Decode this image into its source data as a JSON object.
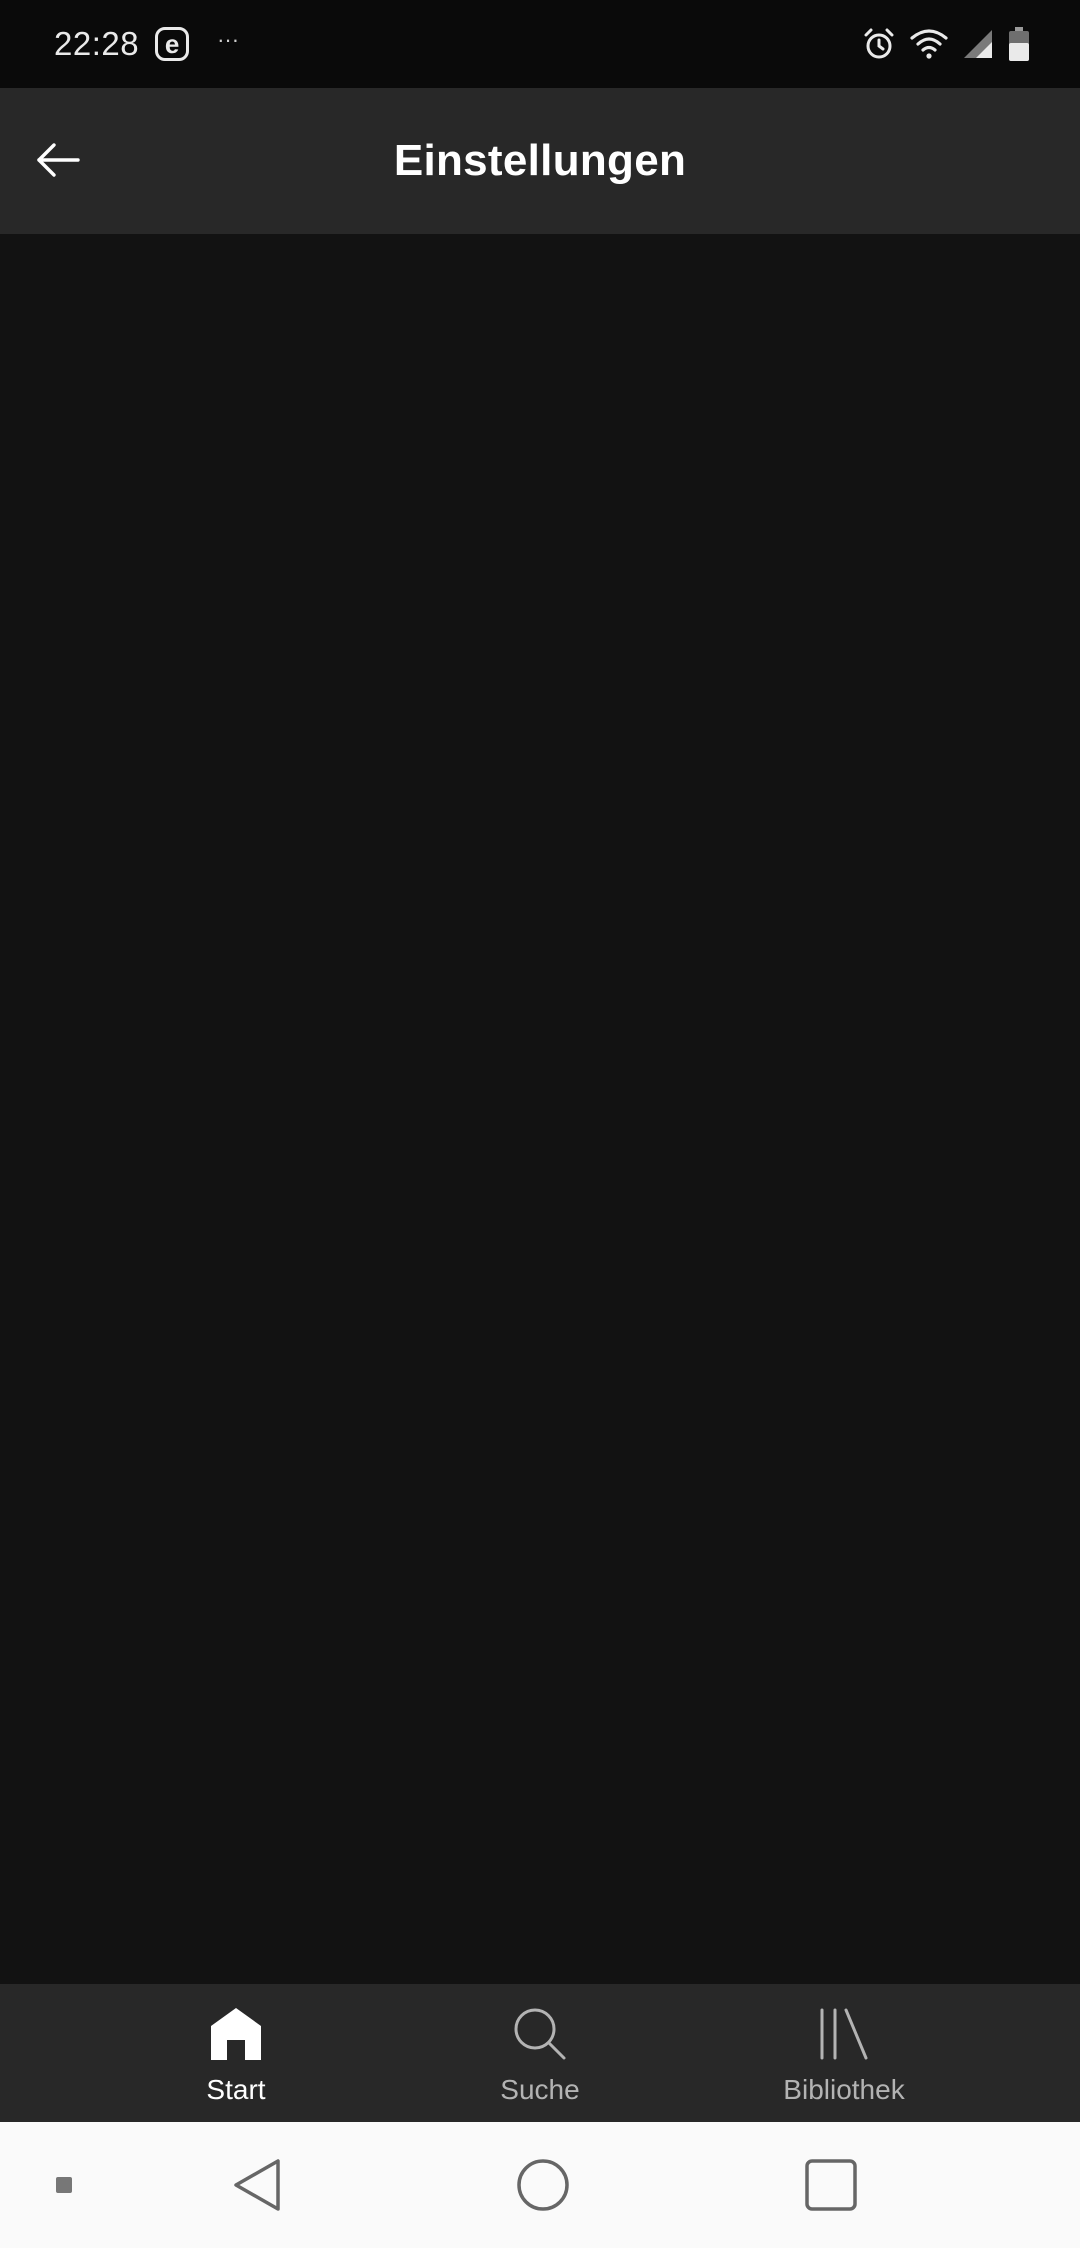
{
  "status_bar": {
    "time": "22:28",
    "badge": "e",
    "dots": "···"
  },
  "header": {
    "title": "Einstellungen"
  },
  "bottom_nav": {
    "items": [
      {
        "label": "Start",
        "icon": "home-icon",
        "active": true
      },
      {
        "label": "Suche",
        "icon": "search-icon",
        "active": false
      },
      {
        "label": "Bibliothek",
        "icon": "library-icon",
        "active": false
      }
    ]
  },
  "colors": {
    "status_bar_bg": "#0a0a0a",
    "header_bg": "#282828",
    "content_bg": "#121212",
    "nav_bg": "#282828",
    "system_nav_bg": "#fafafa",
    "text_primary": "#ffffff",
    "text_secondary": "#b3b3b3"
  }
}
